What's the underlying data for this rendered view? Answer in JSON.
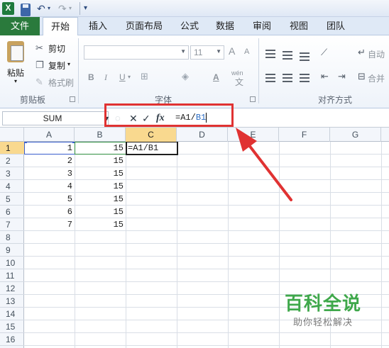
{
  "toolbar": {
    "app_icon": "excel-logo-icon",
    "undo_glyph": "↶",
    "redo_glyph": "↷",
    "customize_glyph": "▾"
  },
  "tabs": [
    {
      "label": "文件"
    },
    {
      "label": "开始"
    },
    {
      "label": "插入"
    },
    {
      "label": "页面布局"
    },
    {
      "label": "公式"
    },
    {
      "label": "数据"
    },
    {
      "label": "审阅"
    },
    {
      "label": "视图"
    },
    {
      "label": "团队"
    }
  ],
  "ribbon": {
    "clipboard": {
      "paste": "粘贴",
      "cut": "剪切",
      "copy": "复制",
      "format_painter": "格式刷",
      "group": "剪贴板"
    },
    "font": {
      "size": "11",
      "grow": "A",
      "shrink": "A",
      "bold": "B",
      "italic": "I",
      "underline": "U",
      "wen": "wén",
      "group": "字体"
    },
    "alignment": {
      "wrap": "自动",
      "merge": "合并",
      "group": "对齐方式"
    }
  },
  "formula_bar": {
    "name_box": "SUM",
    "cancel": "✕",
    "enter": "✓",
    "fx": "fx",
    "formula_prefix": "=A1/",
    "formula_ref": "B1"
  },
  "columns": [
    "A",
    "B",
    "C",
    "D",
    "E",
    "F",
    "G"
  ],
  "rows": [
    "1",
    "2",
    "3",
    "4",
    "5",
    "6",
    "7",
    "8",
    "9",
    "10",
    "11",
    "12",
    "13",
    "14",
    "15",
    "16"
  ],
  "cells": {
    "A": [
      "1",
      "2",
      "3",
      "4",
      "5",
      "6",
      "7"
    ],
    "B": [
      "15",
      "15",
      "15",
      "15",
      "15",
      "15",
      "15"
    ],
    "C1": "=A1/B1"
  },
  "colors": {
    "file_tab": "#2a7a3c",
    "highlight": "#e03232",
    "watermark": "#3fa84b",
    "selected_header": "#f9d98f"
  },
  "watermark": {
    "title": "百科全说",
    "subtitle": "助你轻松解决"
  }
}
